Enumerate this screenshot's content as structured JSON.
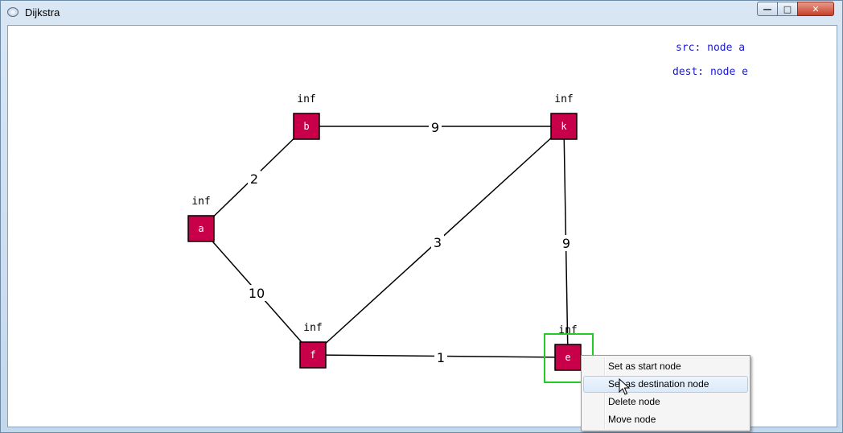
{
  "window": {
    "title": "Dijkstra",
    "minimize_label": "—",
    "maximize_label": "□",
    "close_label": "✕"
  },
  "info": {
    "src": "src: node a",
    "dest": "dest: node e"
  },
  "colors": {
    "node_fill": "#c8004a",
    "node_border": "#000000",
    "edge": "#000000",
    "selection": "#22cc22",
    "info_text": "#1a1acb"
  },
  "graph": {
    "nodes": [
      {
        "id": "a",
        "label": "a",
        "dist": "inf"
      },
      {
        "id": "b",
        "label": "b",
        "dist": "inf"
      },
      {
        "id": "k",
        "label": "k",
        "dist": "inf"
      },
      {
        "id": "f",
        "label": "f",
        "dist": "inf"
      },
      {
        "id": "e",
        "label": "e",
        "dist": "inf",
        "selected": true
      }
    ],
    "edges": [
      {
        "from": "a",
        "to": "b",
        "weight": "2"
      },
      {
        "from": "b",
        "to": "k",
        "weight": "9"
      },
      {
        "from": "a",
        "to": "f",
        "weight": "10"
      },
      {
        "from": "f",
        "to": "k",
        "weight": "3"
      },
      {
        "from": "k",
        "to": "e",
        "weight": "9"
      },
      {
        "from": "f",
        "to": "e",
        "weight": "1"
      }
    ]
  },
  "context_menu": {
    "items": [
      {
        "label": "Set as start node"
      },
      {
        "label": "Set as destination node",
        "hovered": true
      },
      {
        "label": "Delete node"
      },
      {
        "label": "Move node"
      }
    ]
  }
}
